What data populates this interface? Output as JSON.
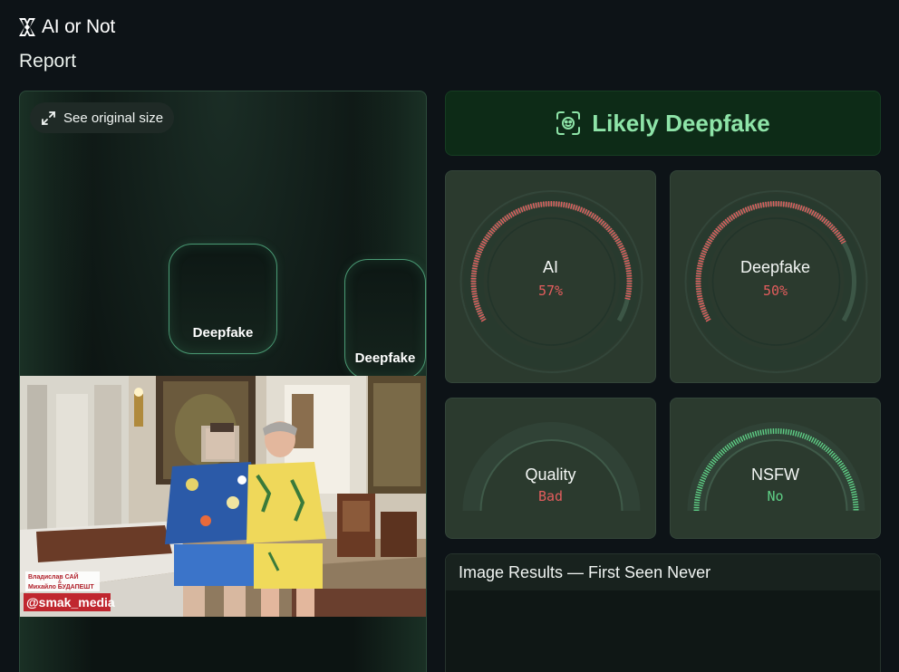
{
  "brand": {
    "name": "AI or Not"
  },
  "page": {
    "title": "Report"
  },
  "image_panel": {
    "see_original_label": "See original size",
    "detections": [
      {
        "label": "Deepfake"
      },
      {
        "label": "Deepfake"
      }
    ],
    "watermark": {
      "line1": "Владислав САЙ",
      "amp": "&",
      "line2": "Михайло БУДАПЕШТ",
      "handle": "@smak_media"
    }
  },
  "verdict": {
    "label": "Likely Deepfake",
    "icon": "face-scan-icon",
    "color": "#8ee4a8"
  },
  "metrics": [
    {
      "label": "AI",
      "value": "57%",
      "fraction": 0.57,
      "color": "#e35d5d"
    },
    {
      "label": "Deepfake",
      "value": "50%",
      "fraction": 0.5,
      "color": "#e35d5d"
    },
    {
      "label": "Quality",
      "value": "Bad",
      "color": "#e35d5d"
    },
    {
      "label": "NSFW",
      "value": "No",
      "color": "#5fcf86"
    }
  ],
  "results": {
    "header": "Image Results — First Seen Never"
  },
  "colors": {
    "background": "#0d1317",
    "card": "#2b3a2e",
    "accent_green": "#8ee4a8",
    "alert_red": "#e35d5d"
  }
}
